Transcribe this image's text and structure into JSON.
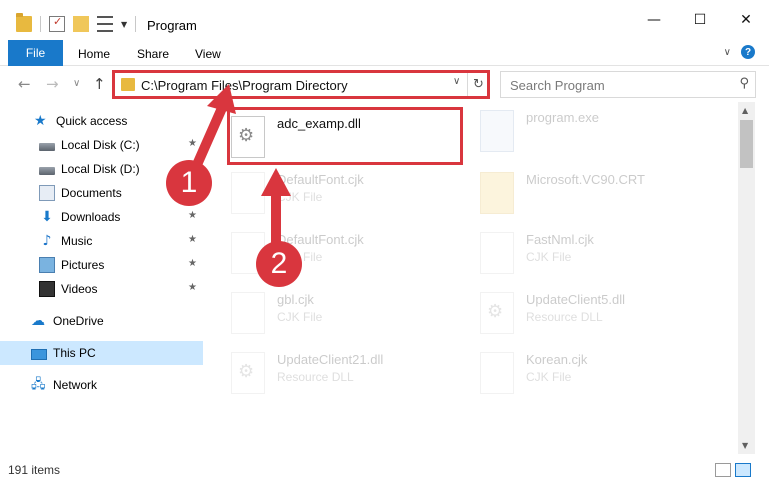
{
  "window": {
    "title": "Program"
  },
  "ribbon": {
    "file": "File",
    "home": "Home",
    "share": "Share",
    "view": "View"
  },
  "address": {
    "path": "C:\\Program Files\\Program Directory"
  },
  "search": {
    "placeholder": "Search Program"
  },
  "sidebar": {
    "items": [
      {
        "label": "Quick access",
        "icon": "star-icon"
      },
      {
        "label": "Local Disk (C:)",
        "icon": "disk-icon",
        "pinned": true
      },
      {
        "label": "Local Disk (D:)",
        "icon": "disk-icon",
        "pinned": true
      },
      {
        "label": "Documents",
        "icon": "documents-icon",
        "pinned": true
      },
      {
        "label": "Downloads",
        "icon": "downloads-icon",
        "pinned": true
      },
      {
        "label": "Music",
        "icon": "music-icon",
        "pinned": true
      },
      {
        "label": "Pictures",
        "icon": "pictures-icon",
        "pinned": true
      },
      {
        "label": "Videos",
        "icon": "videos-icon",
        "pinned": true
      },
      {
        "label": "OneDrive",
        "icon": "cloud-icon"
      },
      {
        "label": "This PC",
        "icon": "pc-icon",
        "selected": true
      },
      {
        "label": "Network",
        "icon": "network-icon"
      }
    ]
  },
  "files": [
    {
      "name": "adc_examp.dll",
      "type": "",
      "icon": "dll-icon"
    },
    {
      "name": "program.exe",
      "type": "",
      "icon": "exe-icon"
    },
    {
      "name": "DefaultFont.cjk",
      "type": "CJK File",
      "icon": "file-icon"
    },
    {
      "name": "Microsoft.VC90.CRT",
      "type": "",
      "icon": "folder-icon"
    },
    {
      "name": "DefaultFont.cjk",
      "type": "CJK File",
      "icon": "file-icon"
    },
    {
      "name": "FastNml.cjk",
      "type": "CJK File",
      "icon": "file-icon"
    },
    {
      "name": "gbl.cjk",
      "type": "CJK File",
      "icon": "file-icon"
    },
    {
      "name": "UpdateClient5.dll",
      "type": "Resource DLL",
      "icon": "dll-icon"
    },
    {
      "name": "UpdateClient21.dll",
      "type": "Resource DLL",
      "icon": "dll-icon"
    },
    {
      "name": "Korean.cjk",
      "type": "CJK File",
      "icon": "file-icon"
    }
  ],
  "status": {
    "items": "191 items"
  },
  "callouts": {
    "one": "1",
    "two": "2"
  },
  "colors": {
    "accent": "#1979ca",
    "highlight": "#d9363e",
    "selected": "#cce8ff"
  }
}
